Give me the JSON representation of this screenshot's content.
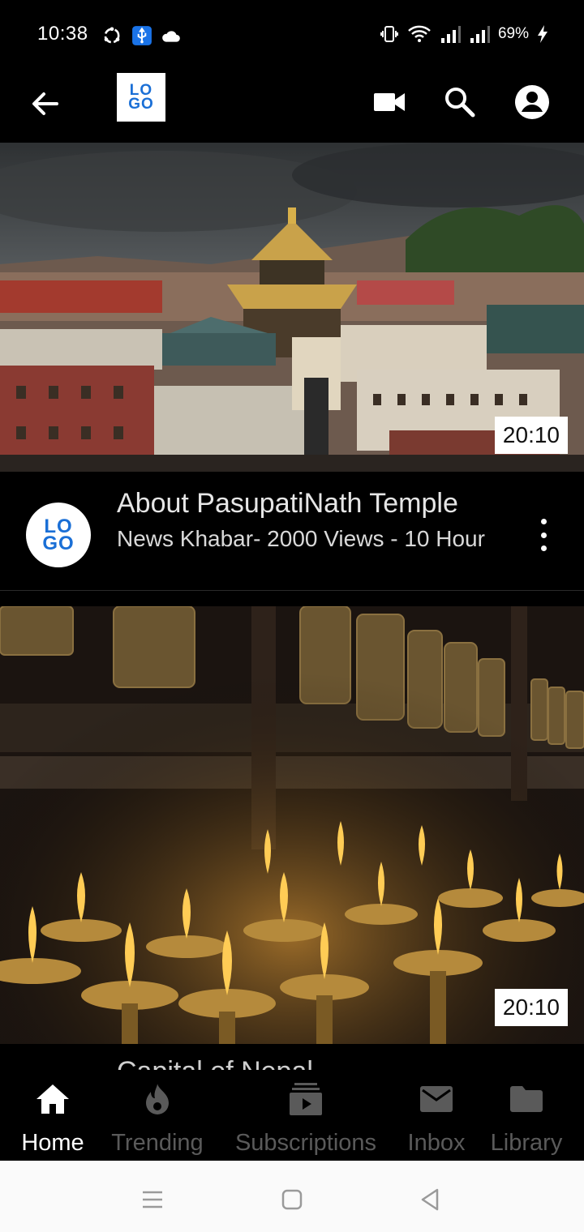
{
  "status_bar": {
    "time": "10:38",
    "battery": "69%",
    "icons": [
      "sync-icon",
      "usb-icon",
      "cloud-icon",
      "vibrate-icon",
      "wifi-icon",
      "signal-icon",
      "signal-icon",
      "charging-icon"
    ]
  },
  "header": {
    "logo_text": "LO GO",
    "logo_line1": "LO",
    "logo_line2": "GO",
    "actions": [
      "video-camera-icon",
      "search-icon",
      "account-icon"
    ]
  },
  "videos": [
    {
      "duration": "20:10",
      "title": "About PasupatiNath Temple",
      "subtitle": "News Khabar- 2000 Views - 10 Hour",
      "channel_logo_line1": "LO",
      "channel_logo_line2": "GO"
    },
    {
      "duration": "20:10",
      "title": "Capital of Nepal"
    }
  ],
  "bottom_nav": {
    "items": [
      {
        "label": "Home",
        "icon": "home-icon",
        "active": true
      },
      {
        "label": "Trending",
        "icon": "fire-icon",
        "active": false
      },
      {
        "label": "Subscriptions",
        "icon": "subscriptions-icon",
        "active": false
      },
      {
        "label": "Inbox",
        "icon": "mail-icon",
        "active": false
      },
      {
        "label": "Library",
        "icon": "folder-icon",
        "active": false
      }
    ]
  },
  "colors": {
    "background": "#000000",
    "logo_blue": "#1a6fd6",
    "inactive_nav": "#5a5a5a"
  }
}
